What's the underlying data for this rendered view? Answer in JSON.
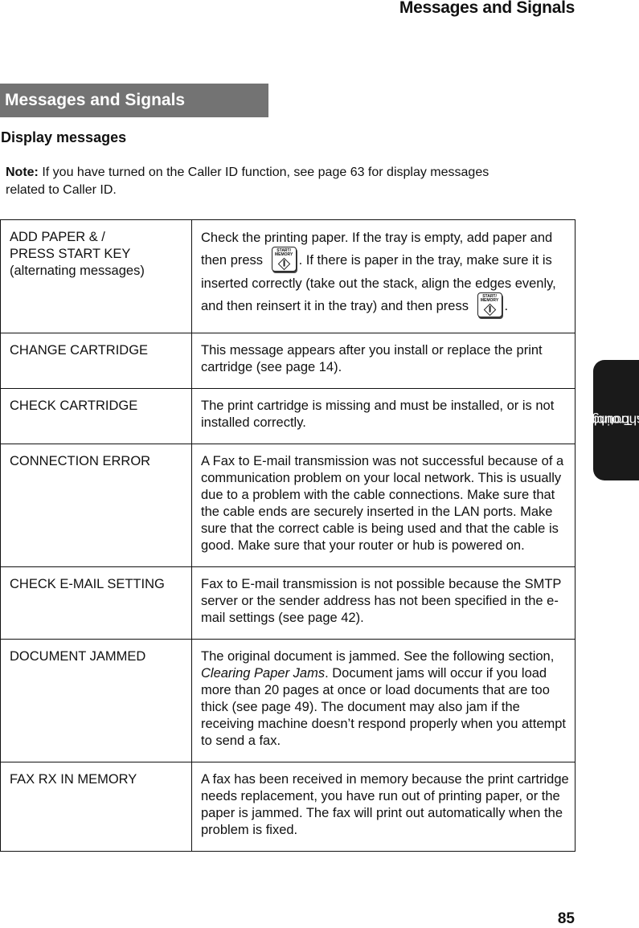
{
  "running_head": "Messages and Signals",
  "section_title": "Messages and Signals",
  "subheading": "Display messages",
  "note": {
    "label": "Note:",
    "text": " If you have turned on the Caller ID function, see page 63 for display messages related to Caller ID."
  },
  "key_icon": {
    "name": "start-memory-key-icon",
    "label_line1": "START/",
    "label_line2": "MEMORY"
  },
  "rows": [
    {
      "code_lines": [
        "ADD PAPER & /",
        "PRESS START KEY",
        "(alternating messages)"
      ],
      "desc_parts": [
        "Check the printing paper. If the tray is empty, add paper and then press ",
        ". If there is paper in the tray, make sure it is inserted correctly (take out the stack, align the edges evenly, and then reinsert it in the tray) and then press ",
        "."
      ]
    },
    {
      "code": "CHANGE CARTRIDGE",
      "desc": "This message appears after you install or replace the print cartridge (see page 14)."
    },
    {
      "code": "CHECK CARTRIDGE",
      "desc": "The print cartridge is missing and must be installed, or is not installed correctly."
    },
    {
      "code": "CONNECTION ERROR",
      "desc": "A Fax to E-mail transmission was not successful because of a communication problem on your local network. This is usually due to a problem with the cable connections. Make sure that the cable ends are securely inserted in the LAN ports. Make sure that the correct cable is being used and that the cable is good. Make sure that your router or hub is powered on."
    },
    {
      "code": "CHECK E-MAIL SETTING",
      "desc": "Fax to E-mail transmission is not possible because the SMTP server or the sender address has not been specified in the e-mail settings (see page 42)."
    },
    {
      "code": "DOCUMENT JAMMED",
      "desc_before": "The original document is jammed. See the following section, ",
      "desc_italic": "Clearing Paper Jams",
      "desc_after": ". Document jams will occur if you load more than 20 pages at once or load documents that are too thick (see page 49). The document may also jam if the receiving machine doesn’t respond properly when you attempt to send a fax."
    },
    {
      "code": "FAX RX IN MEMORY",
      "desc": "A fax has been received in memory because the print cartridge needs replacement, you have run out of printing paper, or the paper is jammed. The fax will print out automatically when the problem is fixed."
    }
  ],
  "side_tab": {
    "line1": "11. Trouble-",
    "line2": "shooting"
  },
  "page_number": "85"
}
